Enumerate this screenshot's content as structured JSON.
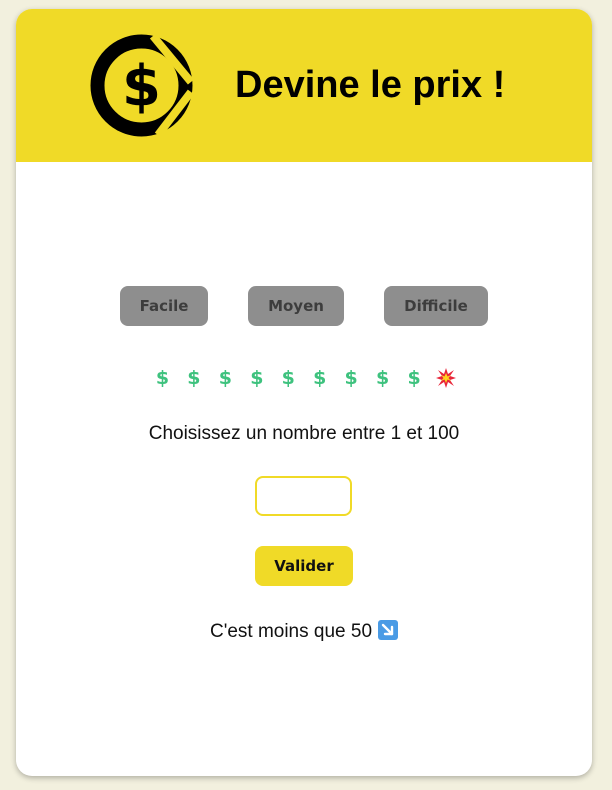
{
  "header": {
    "title": "Devine le prix !",
    "logo_icon": "dollar-coin-icon",
    "background_color": "#f0da27"
  },
  "difficulty": {
    "buttons": [
      {
        "label": "Facile"
      },
      {
        "label": "Moyen"
      },
      {
        "label": "Difficile"
      }
    ]
  },
  "lives": {
    "symbols": [
      "$",
      "$",
      "$",
      "$",
      "$",
      "$",
      "$",
      "$",
      "$"
    ],
    "remaining_icon": "dollar-icon",
    "remaining_color": "#3ec27e",
    "lost_icon": "collision-icon",
    "lost_count": 1
  },
  "game": {
    "prompt": "Choisissez un nombre entre 1 et 100",
    "input_value": "",
    "input_placeholder": "",
    "submit_label": "Valider",
    "feedback": "C'est moins que 50",
    "feedback_icon": "down-right-arrow-icon"
  }
}
